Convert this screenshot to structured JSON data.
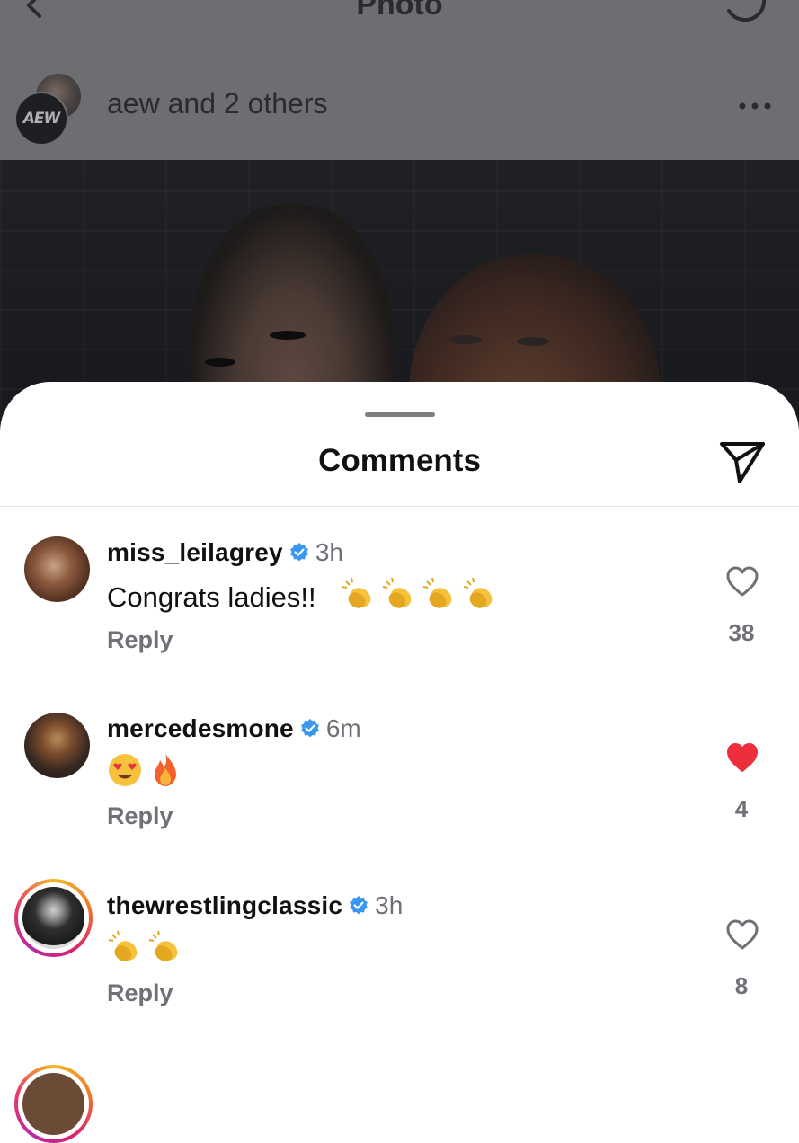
{
  "header": {
    "title": "Photo"
  },
  "post": {
    "owner_text": "aew and 2 others",
    "logo_text": "AEW"
  },
  "sheet": {
    "title": "Comments"
  },
  "comments": [
    {
      "username": "miss_leilagrey",
      "verified": true,
      "time": "3h",
      "text": "Congrats ladies!!",
      "emojis": [
        "clapping-hands",
        "clapping-hands",
        "clapping-hands",
        "clapping-hands"
      ],
      "reply_label": "Reply",
      "liked": false,
      "like_count": "38"
    },
    {
      "username": "mercedesmone",
      "verified": true,
      "time": "6m",
      "text": "",
      "emojis": [
        "heart-eyes-face",
        "fire"
      ],
      "reply_label": "Reply",
      "liked": true,
      "like_count": "4"
    },
    {
      "username": "thewrestlingclassic",
      "verified": true,
      "time": "3h",
      "text": "",
      "emojis": [
        "clapping-hands",
        "clapping-hands"
      ],
      "reply_label": "Reply",
      "liked": false,
      "like_count": "8"
    }
  ],
  "colors": {
    "verified_blue": "#3897f0",
    "like_red": "#ed2f3d",
    "muted_text": "#6f7177"
  }
}
